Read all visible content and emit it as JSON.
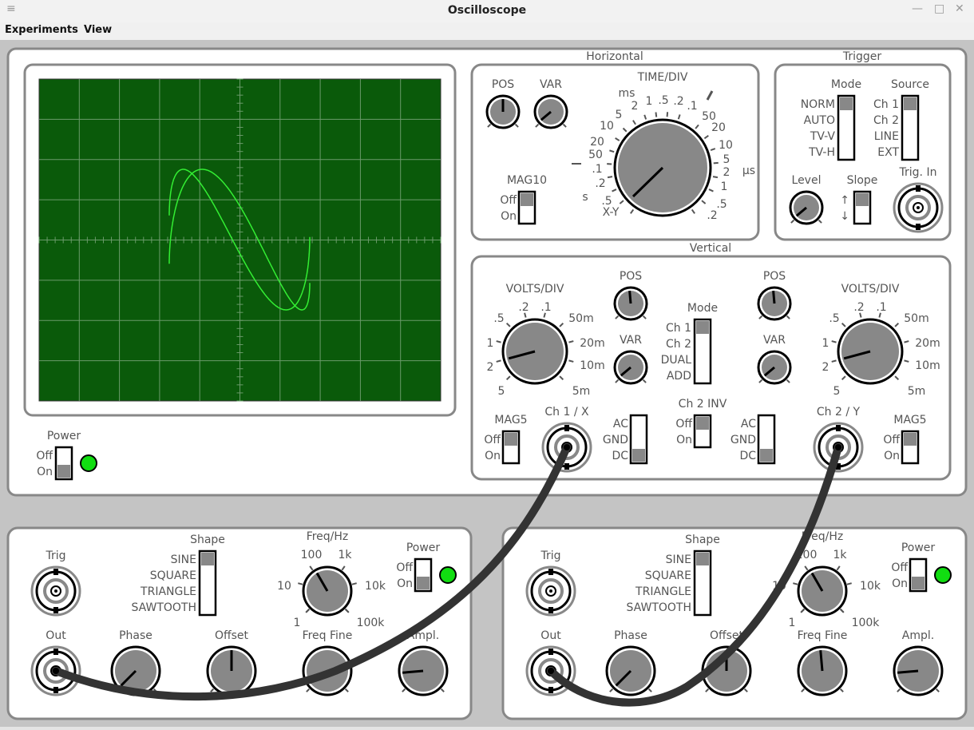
{
  "window": {
    "title": "Oscilloscope",
    "menu_icon": "hamburger-icon",
    "min_icon": "minimize-icon",
    "max_icon": "maximize-icon",
    "close_icon": "close-icon"
  },
  "menu": {
    "items": [
      "Experiments",
      "View"
    ]
  },
  "oscilloscope": {
    "power": {
      "label": "Power",
      "off": "Off",
      "on": "On",
      "state": "On",
      "lamp_color": "#11dd11"
    },
    "horizontal": {
      "title": "Horizontal",
      "pos": "POS",
      "var": "VAR",
      "mag10": "MAG10",
      "off": "Off",
      "on": "On",
      "time_div": "TIME/DIV",
      "unit_labels": [
        "ms",
        "s",
        "µs"
      ],
      "left_ticks": [
        "X-Y",
        ".5",
        ".2",
        ".1",
        "50",
        "20",
        "10",
        "5",
        "2",
        "1",
        ".5",
        ".2",
        ".1"
      ],
      "right_ticks": [
        "50",
        "20",
        "10",
        "5",
        "2",
        "1",
        ".5",
        ".2"
      ]
    },
    "trigger": {
      "title": "Trigger",
      "mode": "Mode",
      "source": "Source",
      "modes": [
        "NORM",
        "AUTO",
        "TV-V",
        "TV-H"
      ],
      "sources": [
        "Ch 1",
        "Ch 2",
        "LINE",
        "EXT"
      ],
      "level": "Level",
      "slope": "Slope",
      "slope_up": "↑",
      "slope_down": "↓",
      "trig_in": "Trig. In"
    },
    "vertical": {
      "title": "Vertical",
      "volts_div": "VOLTS/DIV",
      "pos": "POS",
      "var": "VAR",
      "mode": "Mode",
      "modes": [
        "Ch 1",
        "Ch 2",
        "DUAL",
        "ADD"
      ],
      "ticks": [
        ".5",
        ".2",
        ".1",
        "50m",
        "20m",
        "10m",
        "5m",
        "5",
        "2",
        "1"
      ],
      "mag5": "MAG5",
      "off": "Off",
      "on": "On",
      "ch1": "Ch 1 / X",
      "ch2": "Ch 2 / Y",
      "ch2inv": "Ch 2 INV",
      "coupling": [
        "AC",
        "GND",
        "DC"
      ]
    }
  },
  "generator": {
    "trig": "Trig",
    "shape": "Shape",
    "shapes": [
      "SINE",
      "SQUARE",
      "TRIANGLE",
      "SAWTOOTH"
    ],
    "freq": "Freq/Hz",
    "freq_ticks": [
      "100",
      "1k",
      "10",
      "10k",
      "1",
      "100k"
    ],
    "power": "Power",
    "off": "Off",
    "on": "On",
    "out": "Out",
    "phase": "Phase",
    "offset": "Offset",
    "freq_fine": "Freq Fine",
    "ampl": "Ampl.",
    "lamp_color": "#11dd11"
  },
  "trace": {
    "color": "#33ee33",
    "screen_color": "#0a5a0a",
    "grid_color": "#6a9a6a"
  }
}
